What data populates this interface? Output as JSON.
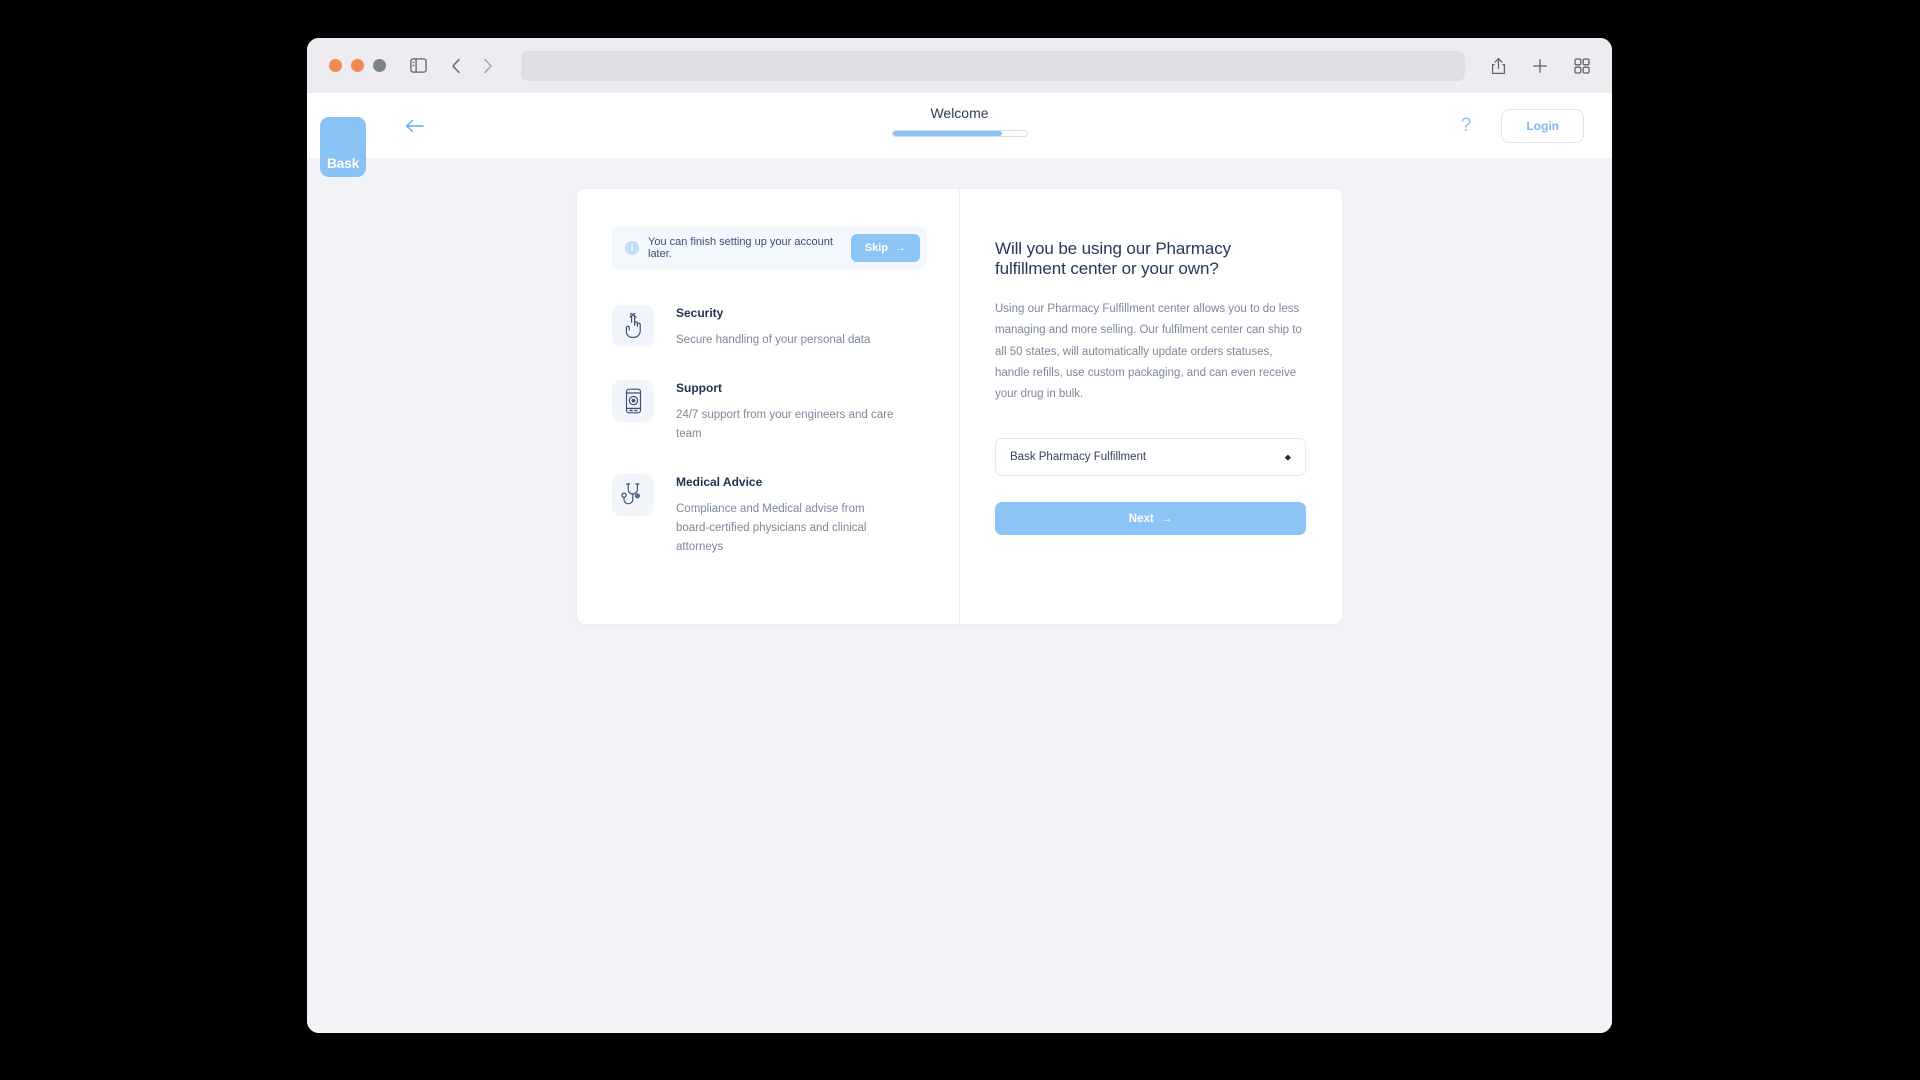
{
  "browser": {
    "traffic_lights": [
      "close",
      "minimize",
      "maximize"
    ],
    "sidebar_icon": "sidebar-icon",
    "back_icon": "chevron-left-icon",
    "forward_icon": "chevron-right-icon",
    "url_value": "",
    "url_placeholder": "",
    "share_icon": "share-icon",
    "new_tab_icon": "plus-icon",
    "tab_overview_icon": "tab-grid-icon"
  },
  "app_header": {
    "logo_text": "Bask",
    "back_label": "back-arrow",
    "title": "Welcome",
    "progress_percent": 82,
    "help_label": "?",
    "login_label": "Login"
  },
  "left_pane": {
    "notice": {
      "info_glyph": "i",
      "text": "You can finish setting up your account later.",
      "skip_label": "Skip",
      "skip_arrow": "→"
    },
    "features": [
      {
        "icon": "fingerprint-hand-icon",
        "title": "Security",
        "description": "Secure handling of your personal data"
      },
      {
        "icon": "mobile-phone-icon",
        "title": "Support",
        "description": "24/7 support from your engineers and care team"
      },
      {
        "icon": "stethoscope-icon",
        "title": "Medical Advice",
        "description": "Compliance and Medical advise from board-certified physicians and clinical attorneys"
      }
    ]
  },
  "right_pane": {
    "question_title": "Will you be using our Pharmacy fulfillment center or your own?",
    "question_body": "Using our Pharmacy Fulfillment center allows you to do less managing and more selling. Our fulfilment center can ship to all 50 states, will automatically update orders statuses, handle refills, use custom packaging, and can even receive your drug in bulk.",
    "select": {
      "value": "Bask Pharmacy Fulfillment",
      "caret": "⬥"
    },
    "next_label": "Next",
    "next_arrow": "→"
  },
  "colors": {
    "accent": "#8dc4f6",
    "page_bg": "#f1f3f7",
    "heading": "#23395c",
    "muted_text": "#7c8799"
  }
}
